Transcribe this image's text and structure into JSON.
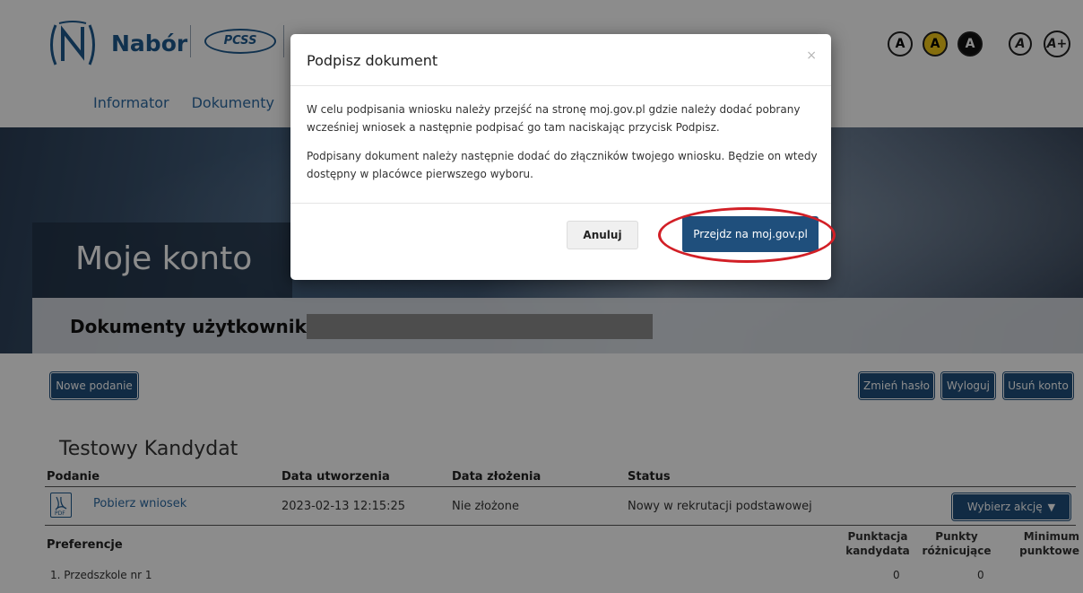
{
  "header": {
    "brand": "Nabór",
    "partner_logo_text": "PCSS",
    "nav": [
      "Informator",
      "Dokumenty"
    ],
    "contrast_options": [
      "A",
      "A",
      "A",
      "A",
      "A+"
    ]
  },
  "banner": {
    "title": "Moje konto",
    "subtitle": "Dokumenty użytkownika"
  },
  "actions": {
    "new_application": "Nowe podanie",
    "change_password": "Zmień hasło",
    "logout": "Wyloguj",
    "delete_account": "Usuń konto"
  },
  "candidate": {
    "name": "Testowy Kandydat",
    "table_headers": [
      "Podanie",
      "Data utworzenia",
      "Data złożenia",
      "Status"
    ],
    "row": {
      "link": "Pobierz wniosek",
      "created": "2023-02-13 12:15:25",
      "submitted": "Nie złożone",
      "status": "Nowy w rekrutacji podstawowej",
      "action_button": "Wybierz akcję"
    },
    "preferences": {
      "label": "Preferencje",
      "columns": [
        "Punktacja kandydata",
        "Punkty różnicujące",
        "Minimum punktowe"
      ],
      "items": [
        {
          "name": "1. Przedszkole nr 1",
          "score": "0",
          "diff_points": "0"
        }
      ]
    }
  },
  "modal": {
    "title": "Podpisz dokument",
    "close_glyph": "×",
    "paragraph1": "W celu podpisania wniosku należy przejść na stronę moj.gov.pl gdzie należy dodać pobrany wcześniej wniosek a następnie podpisać go tam naciskając przycisk Podpisz.",
    "paragraph2": "Podpisany dokument należy następnie dodać do złączników twojego wniosku. Będzie on wtedy dostępny w placówce pierwszego wyboru.",
    "cancel_label": "Anuluj",
    "go_label": "Przejdz na moj.gov.pl",
    "highlight_color": "#d21f26"
  }
}
